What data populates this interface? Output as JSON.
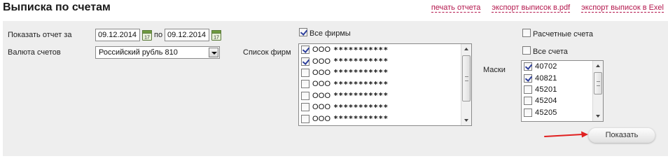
{
  "header": {
    "title": "Выписка по счетам",
    "links": [
      "печать отчета",
      "экспорт выписок в.pdf",
      "экспорт выписок в Exel"
    ]
  },
  "form": {
    "period_label": "Показать отчет за",
    "date_from": "09.12.2014",
    "to_label": "по",
    "date_to": "09.12.2014",
    "currency_label": "Валюта счетов",
    "currency_value": "Российский рубль 810",
    "all_firms_label": "Все фирмы",
    "all_firms_checked": true,
    "firm_list_label": "Список фирм",
    "firms": [
      {
        "name": "ООО",
        "mask": "***********",
        "checked": true
      },
      {
        "name": "ООО",
        "mask": "***********",
        "checked": true
      },
      {
        "name": "ООО",
        "mask": "***********",
        "checked": false
      },
      {
        "name": "ООО",
        "mask": "***********",
        "checked": false
      },
      {
        "name": "ООО",
        "mask": "***********",
        "checked": false
      },
      {
        "name": "ООО",
        "mask": "***********",
        "checked": false
      },
      {
        "name": "ООО",
        "mask": "***********",
        "checked": false
      }
    ],
    "settlement_accounts_label": "Расчетные счета",
    "settlement_accounts_checked": false,
    "all_accounts_label": "Все счета",
    "all_accounts_checked": false,
    "masks_label": "Маски",
    "masks": [
      {
        "value": "40702",
        "checked": true
      },
      {
        "value": "40821",
        "checked": true
      },
      {
        "value": "45201",
        "checked": false
      },
      {
        "value": "45204",
        "checked": false
      },
      {
        "value": "45205",
        "checked": false
      }
    ],
    "show_button": "Показать"
  },
  "colors": {
    "link": "#b4174d",
    "panel_bg": "#eeeeee",
    "check": "#2d3f9c",
    "annotation_arrow": "#e02020"
  },
  "icons": [
    "calendar-icon",
    "dropdown-arrow-icon",
    "checkmark-icon",
    "scroll-up-icon",
    "scroll-down-icon",
    "red-arrow-icon"
  ]
}
